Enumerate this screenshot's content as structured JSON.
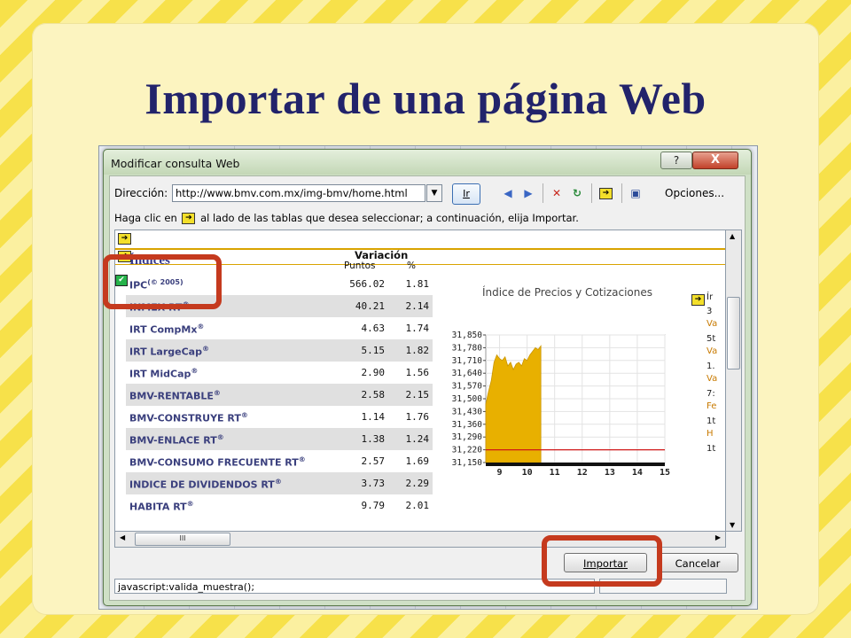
{
  "slide": {
    "title": "Importar de una página Web"
  },
  "dialog": {
    "title": "Modificar consulta Web",
    "help_label": "?",
    "close_label": "X",
    "address_label": "Dirección:",
    "address_value": "http://www.bmv.com.mx/img-bmv/home.html",
    "go_label": "Ir",
    "options_label": "Opciones...",
    "hint_before": "Haga clic en",
    "hint_after": "al lado de las tablas que desea seleccionar; a continuación, elija Importar.",
    "import_label": "Importar",
    "cancel_label": "Cancelar",
    "status_text": "javascript:valida_muestra();",
    "hscroll_thumb": "III"
  },
  "web": {
    "indices_label": "Índices",
    "variation_label": "Variación",
    "points_label": "Puntos",
    "percent_label": "%",
    "rows": [
      {
        "name": "IPC",
        "sup": "(© 2005)",
        "points": "566.02",
        "pct": "1.81"
      },
      {
        "name": "INMEX RT",
        "sup": "®",
        "points": "40.21",
        "pct": "2.14"
      },
      {
        "name": "IRT CompMx",
        "sup": "®",
        "points": "4.63",
        "pct": "1.74"
      },
      {
        "name": "IRT LargeCap",
        "sup": "®",
        "points": "5.15",
        "pct": "1.82"
      },
      {
        "name": "IRT MidCap",
        "sup": "®",
        "points": "2.90",
        "pct": "1.56"
      },
      {
        "name": "BMV-RENTABLE",
        "sup": "®",
        "points": "2.58",
        "pct": "2.15"
      },
      {
        "name": "BMV-CONSTRUYE RT",
        "sup": "®",
        "points": "1.14",
        "pct": "1.76"
      },
      {
        "name": "BMV-ENLACE RT",
        "sup": "®",
        "points": "1.38",
        "pct": "1.24"
      },
      {
        "name": "BMV-CONSUMO FRECUENTE RT",
        "sup": "®",
        "points": "2.57",
        "pct": "1.69"
      },
      {
        "name": "INDICE DE DIVIDENDOS RT",
        "sup": "®",
        "points": "3.73",
        "pct": "2.29"
      },
      {
        "name": "HABITA RT",
        "sup": "®",
        "points": "9.79",
        "pct": "2.01"
      }
    ],
    "right_column": [
      "Ír",
      "3",
      "Va",
      "5t",
      "Va",
      "1.",
      "Va",
      "7:",
      "Fe",
      "1t",
      "H",
      "1t"
    ],
    "colors": {
      "accent_red": "#c53a1e",
      "title_blue": "#22236b",
      "area_gold": "#e8b000",
      "index_name": "#3a3f7d"
    }
  },
  "chart_data": {
    "type": "area",
    "title": "Índice de Precios y Cotizaciones",
    "x_ticks": [
      "9",
      "10",
      "11",
      "12",
      "13",
      "14",
      "15"
    ],
    "y_ticks": [
      "31,850",
      "31,780",
      "31,710",
      "31,640",
      "31,570",
      "31,500",
      "31,430",
      "31,360",
      "31,290",
      "31,220",
      "31,150"
    ],
    "ylim": [
      31150,
      31850
    ],
    "xlim": [
      8.5,
      15
    ],
    "reference_line": 31220,
    "x": [
      8.5,
      8.6,
      8.7,
      8.8,
      8.9,
      9.0,
      9.1,
      9.2,
      9.3,
      9.4,
      9.5,
      9.6,
      9.7,
      9.8,
      9.9,
      10.0,
      10.1,
      10.2,
      10.3,
      10.4,
      10.5
    ],
    "values": [
      31470,
      31540,
      31600,
      31700,
      31740,
      31720,
      31710,
      31730,
      31680,
      31700,
      31660,
      31690,
      31700,
      31680,
      31720,
      31710,
      31740,
      31760,
      31780,
      31770,
      31790
    ]
  }
}
